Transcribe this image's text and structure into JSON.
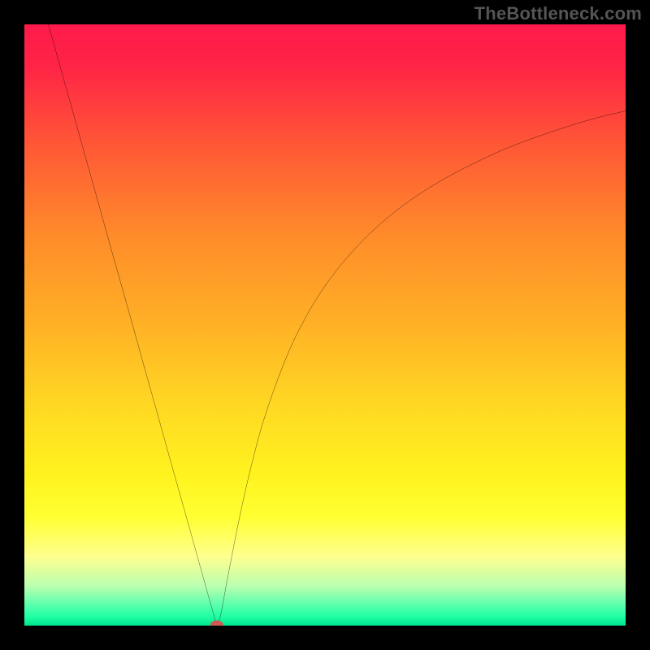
{
  "attribution": "TheBottleneck.com",
  "chart_data": {
    "type": "line",
    "title": "",
    "xlabel": "",
    "ylabel": "",
    "xlim": [
      0,
      100
    ],
    "ylim": [
      0,
      100
    ],
    "background_gradient": {
      "stops": [
        {
          "offset": 0.0,
          "color": "#ff1a4b"
        },
        {
          "offset": 0.07,
          "color": "#ff2446"
        },
        {
          "offset": 0.2,
          "color": "#ff5736"
        },
        {
          "offset": 0.35,
          "color": "#ff8b2a"
        },
        {
          "offset": 0.5,
          "color": "#ffb125"
        },
        {
          "offset": 0.63,
          "color": "#ffd723"
        },
        {
          "offset": 0.75,
          "color": "#fff31f"
        },
        {
          "offset": 0.82,
          "color": "#ffff33"
        },
        {
          "offset": 0.885,
          "color": "#ffff8f"
        },
        {
          "offset": 0.935,
          "color": "#b8ffb0"
        },
        {
          "offset": 0.965,
          "color": "#5cffad"
        },
        {
          "offset": 0.985,
          "color": "#1fffa4"
        },
        {
          "offset": 1.0,
          "color": "#00e58c"
        }
      ]
    },
    "series": [
      {
        "name": "bottleneck-left",
        "stroke": "#000000",
        "stroke_width": 2.4,
        "points": [
          {
            "x": 4.0,
            "y": 100.0
          },
          {
            "x": 6.0,
            "y": 92.8
          },
          {
            "x": 8.0,
            "y": 85.7
          },
          {
            "x": 10.0,
            "y": 78.5
          },
          {
            "x": 12.0,
            "y": 71.4
          },
          {
            "x": 14.0,
            "y": 64.2
          },
          {
            "x": 16.0,
            "y": 57.1
          },
          {
            "x": 18.0,
            "y": 50.0
          },
          {
            "x": 20.0,
            "y": 42.8
          },
          {
            "x": 22.0,
            "y": 35.7
          },
          {
            "x": 24.0,
            "y": 28.5
          },
          {
            "x": 26.0,
            "y": 21.4
          },
          {
            "x": 28.0,
            "y": 14.3
          },
          {
            "x": 30.0,
            "y": 7.1
          },
          {
            "x": 31.5,
            "y": 1.8
          },
          {
            "x": 32.0,
            "y": 0.0
          }
        ]
      },
      {
        "name": "bottleneck-right",
        "stroke": "#000000",
        "stroke_width": 2.4,
        "points": [
          {
            "x": 32.0,
            "y": 0.0
          },
          {
            "x": 32.7,
            "y": 2.0
          },
          {
            "x": 34.0,
            "y": 9.0
          },
          {
            "x": 36.0,
            "y": 19.0
          },
          {
            "x": 38.0,
            "y": 27.6
          },
          {
            "x": 40.0,
            "y": 34.8
          },
          {
            "x": 43.0,
            "y": 43.2
          },
          {
            "x": 46.0,
            "y": 49.8
          },
          {
            "x": 50.0,
            "y": 56.5
          },
          {
            "x": 55.0,
            "y": 62.7
          },
          {
            "x": 60.0,
            "y": 67.5
          },
          {
            "x": 65.0,
            "y": 71.3
          },
          {
            "x": 70.0,
            "y": 74.4
          },
          {
            "x": 75.0,
            "y": 77.0
          },
          {
            "x": 80.0,
            "y": 79.3
          },
          {
            "x": 85.0,
            "y": 81.2
          },
          {
            "x": 90.0,
            "y": 82.9
          },
          {
            "x": 95.0,
            "y": 84.4
          },
          {
            "x": 100.0,
            "y": 85.6
          }
        ]
      }
    ],
    "marker": {
      "name": "optimal-point",
      "x": 32.0,
      "y": 0.0,
      "rx": 1.1,
      "ry": 0.9,
      "fill": "#cf5a53"
    }
  }
}
